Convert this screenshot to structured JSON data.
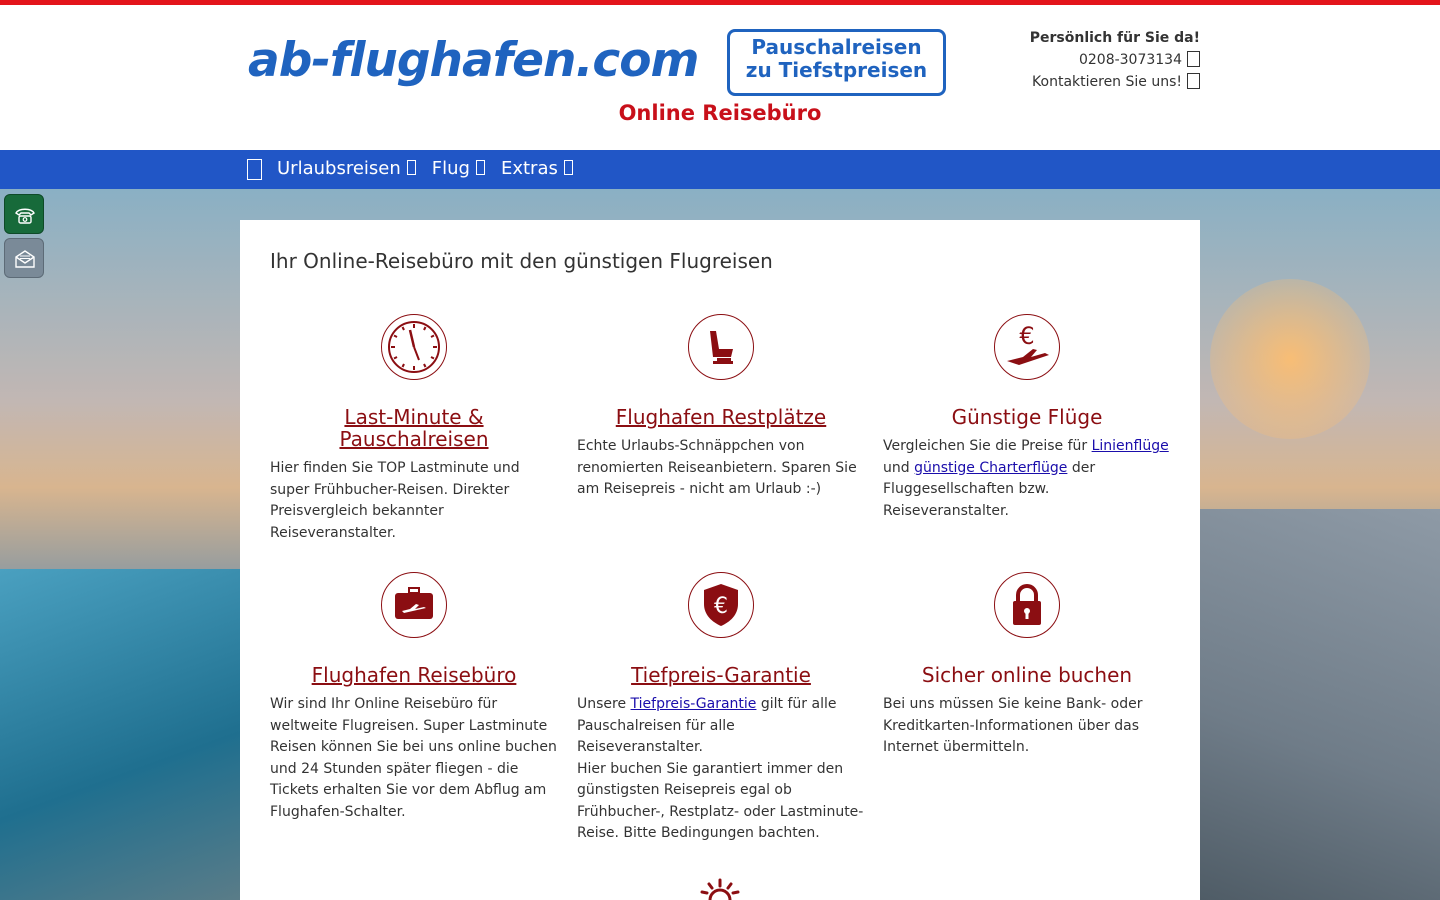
{
  "header": {
    "logo_text": "ab-flughafen.com",
    "promo_line1": "Pauschalreisen",
    "promo_line2": "zu Tiefstpreisen",
    "tagline": "Online Reisebüro",
    "contact_title": "Persönlich für Sie da!",
    "phone": "0208-3073134",
    "contact_link": "Kontaktieren Sie uns!"
  },
  "nav": {
    "items": [
      "Urlaubsreisen",
      "Flug",
      "Extras"
    ]
  },
  "side_buttons": {
    "phone_icon": "phone-icon",
    "mail_icon": "mail-icon"
  },
  "main": {
    "heading": "Ihr Online-Reisebüro mit den günstigen Flugreisen",
    "cards": [
      {
        "icon": "clock-icon",
        "title": "Last-Minute & Pauschalreisen",
        "text": "Hier finden Sie TOP Lastminute und super Frühbucher-Reisen. Direkter Preisvergleich bekannter Reiseveranstalter."
      },
      {
        "icon": "seat-icon",
        "title": "Flughafen Restplätze",
        "text": "Echte Urlaubs-Schnäppchen von renomierten Reiseanbietern. Sparen Sie am Reisepreis - nicht am Urlaub :-)"
      },
      {
        "icon": "euro-plane-icon",
        "title": "Günstige Flüge",
        "text_before": "Vergleichen Sie die Preise für ",
        "link1": "Linienflüge",
        "text_mid": " und ",
        "link2": "günstige Charterflüge",
        "text_after": " der Fluggesellschaften bzw. Reiseveranstalter."
      },
      {
        "icon": "suitcase-plane-icon",
        "title": "Flughafen Reisebüro",
        "text": "Wir sind Ihr Online Reisebüro für weltweite Flugreisen. Super Lastminute Reisen können Sie bei uns online buchen und 24 Stunden später fliegen - die Tickets erhalten Sie vor dem Abflug am Flughafen-Schalter."
      },
      {
        "icon": "euro-shield-icon",
        "title": "Tiefpreis-Garantie",
        "text_before": "Unsere ",
        "link1": "Tiefpreis-Garantie",
        "text_after": " gilt für alle Pauschalreisen für alle Reiseveranstalter.",
        "text2": "Hier buchen Sie garantiert immer den günstigsten Reisepreis egal ob Frühbucher-, Restplatz- oder Lastminute-Reise. Bitte Bedingungen bachten."
      },
      {
        "icon": "lock-icon",
        "title": "Sicher online buchen",
        "text": "Bei uns müssen Sie keine Bank- oder Kreditkarten-Informationen über das Internet übermitteln."
      }
    ]
  },
  "colors": {
    "brand_blue": "#1f63bf",
    "nav_blue": "#2156c6",
    "accent_red": "#c8101a",
    "dark_red": "#8b0e12"
  }
}
